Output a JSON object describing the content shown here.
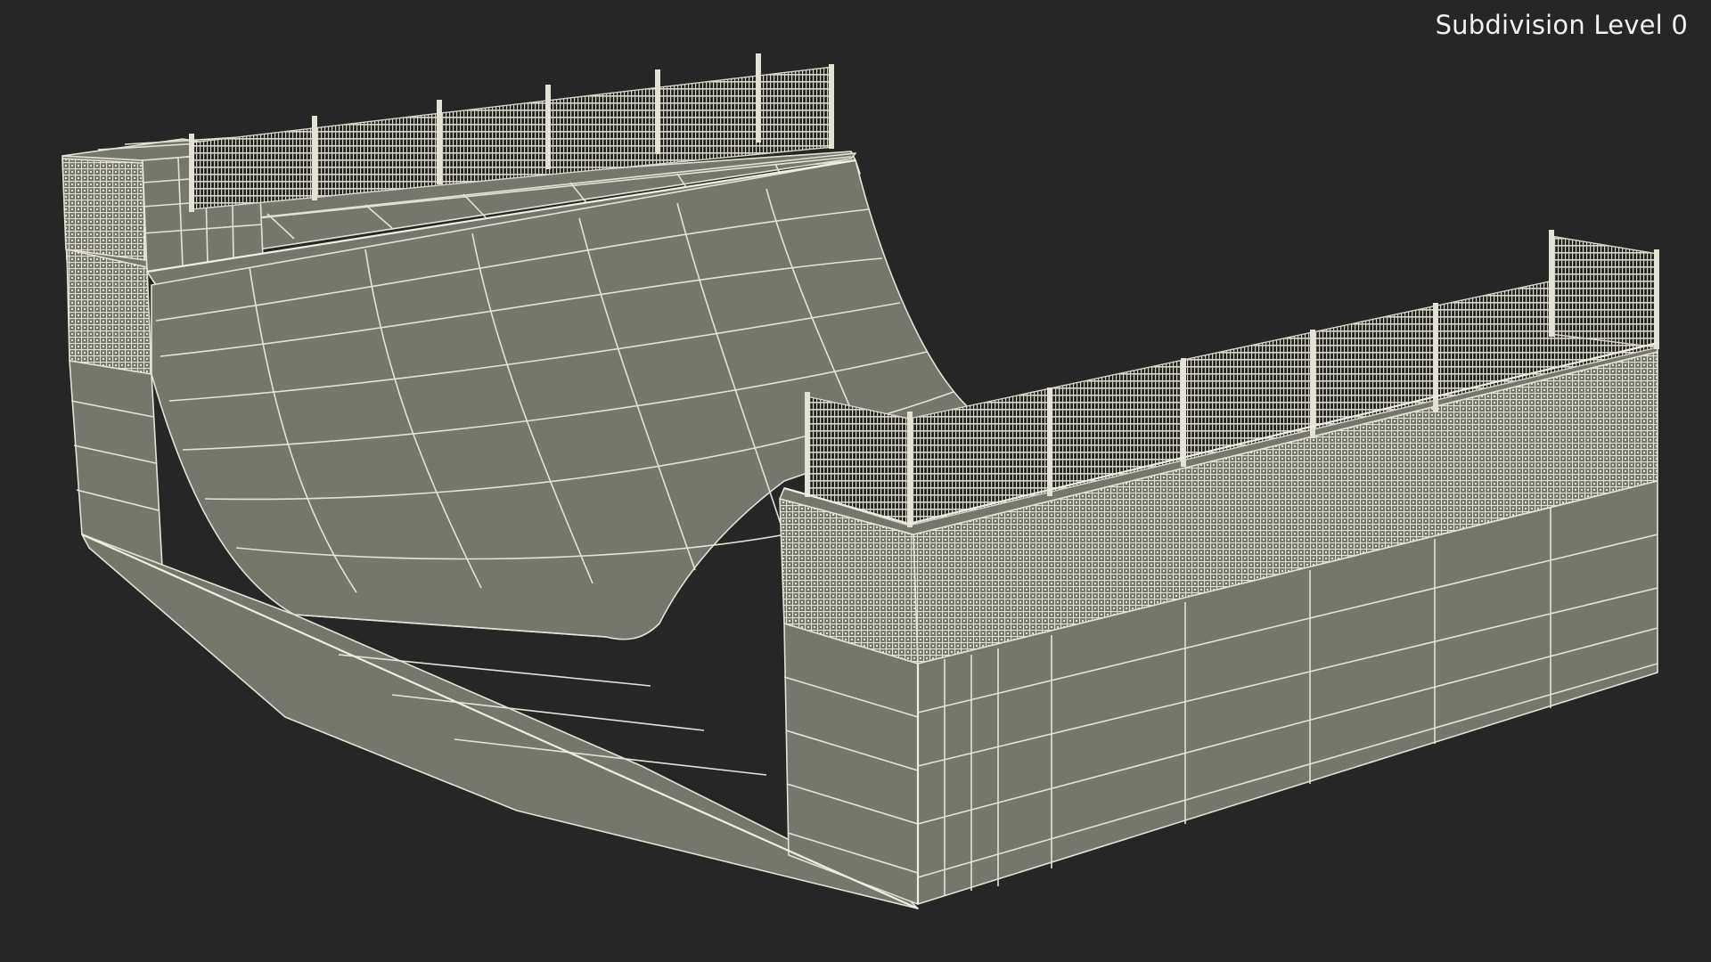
{
  "viewport": {
    "subdivision_label": "Subdivision Level 0",
    "background_color": "#262626",
    "model_fill_color": "#76776c",
    "wire_color": "#e4e2d4"
  },
  "scene": {
    "subject": "half-pipe-ramp-wireframe",
    "icons": [
      "mesh-pattern",
      "fence-post"
    ]
  }
}
